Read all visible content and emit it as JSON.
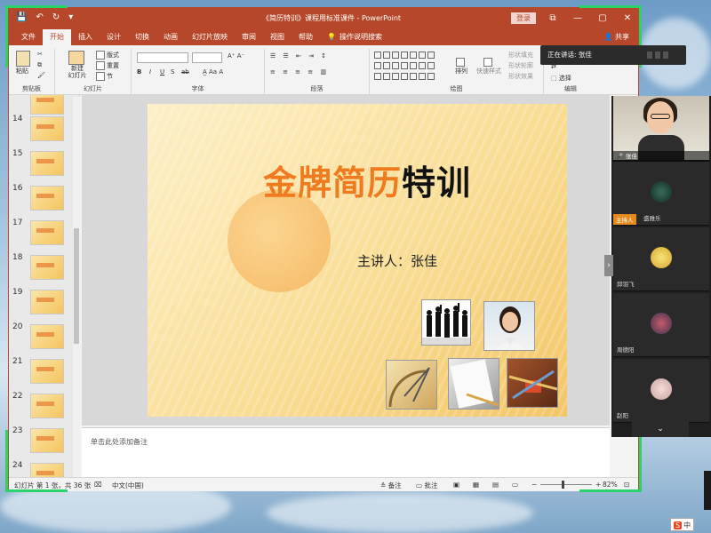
{
  "window": {
    "title": "《简历特训》课程用标准课件 - PowerPoint",
    "login_label": "登录",
    "minimize": "—",
    "restore": "▢",
    "close": "✕",
    "ribbon_display": "⧉"
  },
  "qat": {
    "save": "💾",
    "undo": "↶",
    "redo": "↻",
    "customize": "▾"
  },
  "tabs": [
    "文件",
    "开始",
    "插入",
    "设计",
    "切换",
    "动画",
    "幻灯片放映",
    "审阅",
    "视图",
    "帮助"
  ],
  "active_tab": "开始",
  "tell_me": "操作说明搜索",
  "share": "共享",
  "ribbon": {
    "clipboard": {
      "label": "剪贴板",
      "paste": "粘贴"
    },
    "slides": {
      "label": "幻灯片",
      "new_slide": "新建\n幻灯片",
      "layout": "版式",
      "reset": "重置",
      "section": "节"
    },
    "font": {
      "label": "字体",
      "bold": "B",
      "italic": "I",
      "underline": "U",
      "strike": "S",
      "shadow": "ab"
    },
    "paragraph": {
      "label": "段落"
    },
    "drawing": {
      "label": "绘图",
      "arrange": "排列",
      "quick_styles": "快速样式",
      "fill": "形状填充",
      "outline": "形状轮廓",
      "effects": "形状效果"
    },
    "editing": {
      "label": "编辑",
      "select": "选择"
    }
  },
  "thumbnails": [
    {
      "num": "14"
    },
    {
      "num": "15"
    },
    {
      "num": "16"
    },
    {
      "num": "17"
    },
    {
      "num": "18"
    },
    {
      "num": "19"
    },
    {
      "num": "20"
    },
    {
      "num": "21"
    },
    {
      "num": "22"
    },
    {
      "num": "23"
    },
    {
      "num": "24"
    }
  ],
  "slide": {
    "title_part1": "金牌简历",
    "title_part2": "特训",
    "speaker": "主讲人：张佳"
  },
  "notes_placeholder": "单击此处添加备注",
  "status": {
    "slide_info": "幻灯片 第 1 张，共 36 张",
    "language": "中文(中国)",
    "notes": "备注",
    "comments": "批注",
    "zoom": "82%"
  },
  "meeting": {
    "speaking_now": "正在讲话: 张佳",
    "self_name": "张佳",
    "host_badge": "主持人",
    "participants": [
      "盛雅乐",
      "邱羽飞",
      "周德阳",
      "赵阳"
    ],
    "more": "⌄"
  },
  "ime": {
    "logo": "S",
    "lang": "中"
  }
}
